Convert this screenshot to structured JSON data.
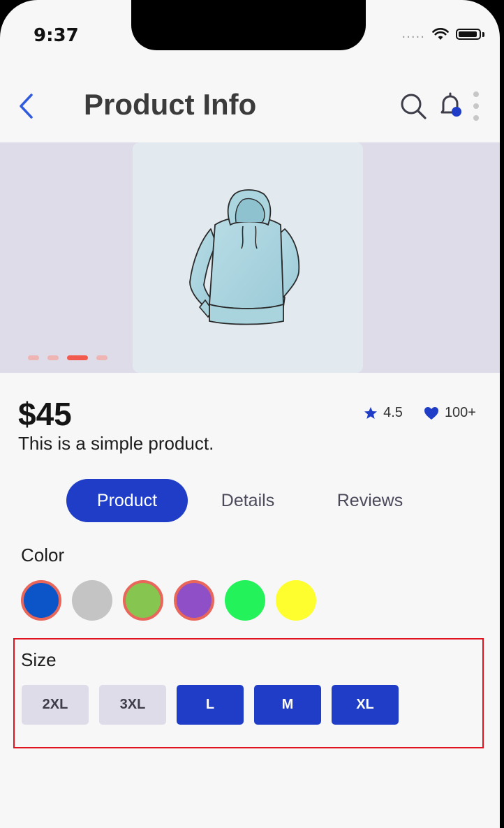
{
  "status": {
    "time": "9:37",
    "signal": "....."
  },
  "header": {
    "title": "Product Info"
  },
  "colors": {
    "accent": "#1f3dc6",
    "highlight": "#e0141e",
    "dot_active": "#f25a4d"
  },
  "product": {
    "price": "$45",
    "description": "This is a simple product.",
    "rating": "4.5",
    "likes": "100+",
    "carousel": {
      "count": 4,
      "active_index": 2
    }
  },
  "tabs": [
    {
      "label": "Product",
      "active": true
    },
    {
      "label": "Details",
      "active": false
    },
    {
      "label": "Reviews",
      "active": false
    }
  ],
  "color_section": {
    "label": "Color",
    "swatches": [
      {
        "color": "#0b55c9",
        "selected": true
      },
      {
        "color": "#c4c4c4",
        "selected": false
      },
      {
        "color": "#86c54f",
        "selected": true
      },
      {
        "color": "#8e4fc7",
        "selected": true
      },
      {
        "color": "#23f25a",
        "selected": false
      },
      {
        "color": "#fefe2e",
        "selected": false
      }
    ]
  },
  "size_section": {
    "label": "Size",
    "options": [
      {
        "label": "2XL",
        "selected": false
      },
      {
        "label": "3XL",
        "selected": false
      },
      {
        "label": "L",
        "selected": true
      },
      {
        "label": "M",
        "selected": true
      },
      {
        "label": "XL",
        "selected": true
      }
    ]
  }
}
